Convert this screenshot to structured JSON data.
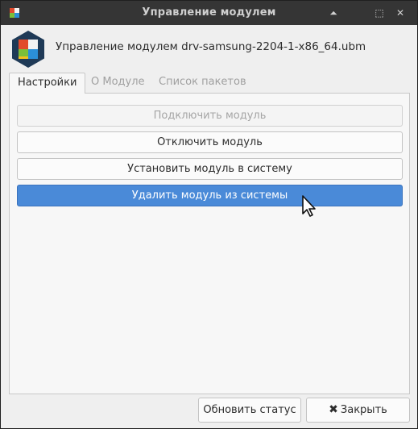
{
  "window": {
    "title": "Управление модулем"
  },
  "titlebar_buttons": {
    "shade_icon": "⏶",
    "maximize_icon": "⬚",
    "close_icon": "✕"
  },
  "header": {
    "module_text": "Управление модулем drv-samsung-2204-1-x86_64.ubm"
  },
  "tabs": [
    {
      "label": "Настройки",
      "active": true
    },
    {
      "label": "О Модуле",
      "active": false
    },
    {
      "label": "Список пакетов",
      "active": false
    }
  ],
  "actions": {
    "connect": "Подключить модуль",
    "disconnect": "Отключить модуль",
    "install": "Установить модуль в систему",
    "remove": "Удалить модуль из системы"
  },
  "footer": {
    "refresh_label": "Обновить статус",
    "close_label": "Закрыть",
    "close_icon": "✖"
  },
  "colors": {
    "accent": "#4a8ad8",
    "titlebar": "#353535",
    "logo_red": "#e24a2c",
    "logo_green": "#7bbf3a",
    "logo_blue": "#2b8fd8",
    "logo_yellow": "#f4c01e",
    "hexagon": "#1f3a57"
  }
}
